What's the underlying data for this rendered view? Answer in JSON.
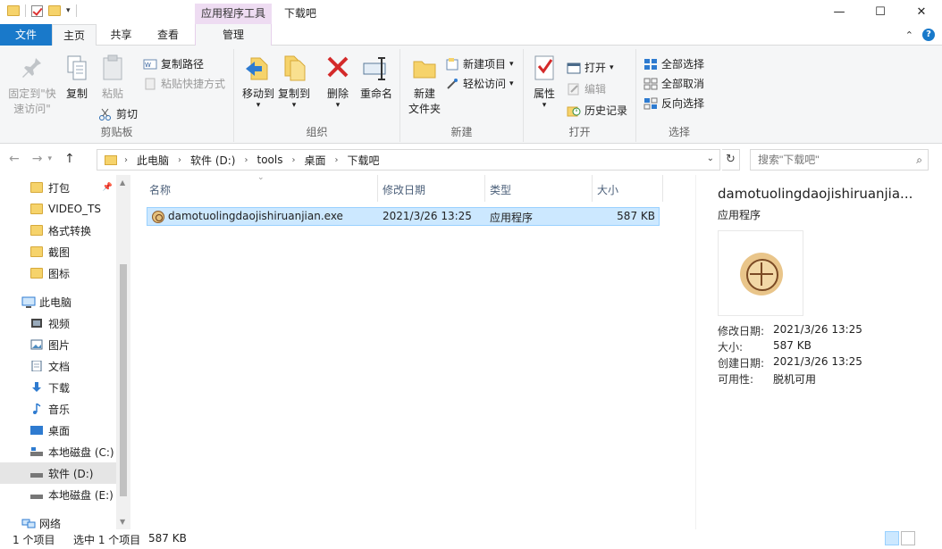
{
  "window": {
    "title": "下载吧",
    "context_tab_top": "应用程序工具",
    "minimize": "—",
    "maximize": "☐",
    "close": "✕"
  },
  "tabs": {
    "file": "文件",
    "home": "主页",
    "share": "共享",
    "view": "查看",
    "manage": "管理"
  },
  "ribbon": {
    "clipboard": {
      "label": "剪贴板",
      "pin_line1": "固定到\"快",
      "pin_line2": "速访问\"",
      "copy": "复制",
      "paste": "粘贴",
      "copy_path": "复制路径",
      "paste_shortcut": "粘贴快捷方式",
      "cut": "剪切"
    },
    "organize": {
      "label": "组织",
      "move_to": "移动到",
      "copy_to": "复制到",
      "delete": "删除",
      "rename": "重命名"
    },
    "new": {
      "label": "新建",
      "new_folder_line1": "新建",
      "new_folder_line2": "文件夹",
      "new_item": "新建项目",
      "easy_access": "轻松访问"
    },
    "open": {
      "label": "打开",
      "properties": "属性",
      "open": "打开",
      "edit": "编辑",
      "history": "历史记录"
    },
    "select": {
      "label": "选择",
      "select_all": "全部选择",
      "select_none": "全部取消",
      "invert": "反向选择"
    }
  },
  "address": {
    "crumbs": [
      "此电脑",
      "软件 (D:)",
      "tools",
      "桌面",
      "下载吧"
    ],
    "search_placeholder": "搜索\"下载吧\""
  },
  "nav": {
    "quick": [
      "打包",
      "VIDEO_TS",
      "格式转换",
      "截图",
      "图标"
    ],
    "this_pc": "此电脑",
    "pc_items": [
      "视频",
      "图片",
      "文档",
      "下载",
      "音乐",
      "桌面",
      "本地磁盘 (C:)",
      "软件 (D:)",
      "本地磁盘 (E:)"
    ],
    "network": "网络"
  },
  "columns": {
    "name": "名称",
    "modified": "修改日期",
    "type": "类型",
    "size": "大小"
  },
  "files": [
    {
      "name": "damotuolingdaojishiruanjian.exe",
      "modified": "2021/3/26 13:25",
      "type": "应用程序",
      "size": "587 KB"
    }
  ],
  "preview": {
    "title": "damotuolingdaojishiruanjia...",
    "type": "应用程序",
    "props": [
      {
        "k": "修改日期:",
        "v": "2021/3/26 13:25"
      },
      {
        "k": "大小:",
        "v": "587 KB"
      },
      {
        "k": "创建日期:",
        "v": "2021/3/26 13:25"
      },
      {
        "k": "可用性:",
        "v": "脱机可用"
      }
    ]
  },
  "status": {
    "count": "1 个项目",
    "selected": "选中 1 个项目",
    "sel_size": "587 KB"
  }
}
